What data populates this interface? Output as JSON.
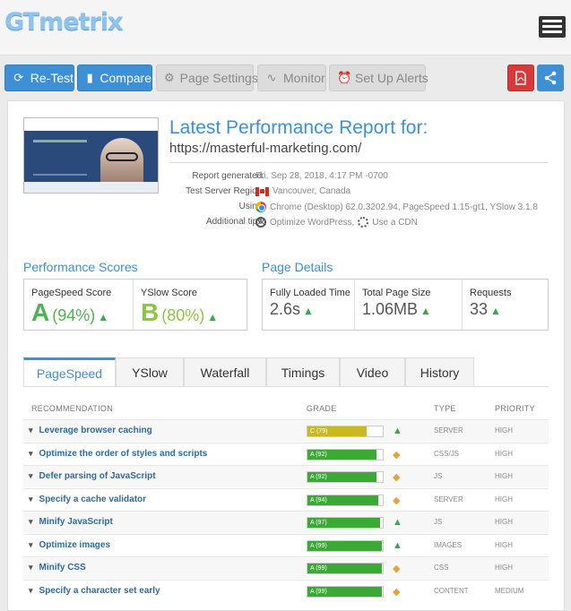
{
  "header": {
    "logo": "GTmetrix",
    "menu_icon": "hamburger-menu-icon"
  },
  "toolbar": {
    "retest": "Re-Test",
    "compare": "Compare",
    "page_settings": "Page Settings",
    "monitor": "Monitor",
    "alerts": "Set Up Alerts",
    "pdf_icon": "pdf-icon",
    "share_icon": "share-icon"
  },
  "report": {
    "title": "Latest Performance Report for:",
    "url": "https://masterful-marketing.com/",
    "meta": [
      {
        "label": "Report generated:",
        "value": "Fri, Sep 28, 2018, 4:17 PM -0700",
        "icon": ""
      },
      {
        "label": "Test Server Region:",
        "value": "Vancouver, Canada",
        "icon": "canada-flag-icon"
      },
      {
        "label": "Using:",
        "value": "Chrome (Desktop) 62.0.3202.94, PageSpeed 1.15-gt1, YSlow 3.1.8",
        "icon": "chrome-icon"
      },
      {
        "label": "Additional tips:",
        "value": "Optimize WordPress,",
        "value2": "Use a CDN",
        "icon": "wordpress-icon",
        "icon2": "cdn-icon"
      }
    ]
  },
  "scores": {
    "title": "Performance Scores",
    "pagespeed": {
      "label": "PageSpeed Score",
      "grade": "A",
      "pct": "(94%)"
    },
    "yslow": {
      "label": "YSlow Score",
      "grade": "B",
      "pct": "(80%)"
    }
  },
  "details": {
    "title": "Page Details",
    "load": {
      "label": "Fully Loaded Time",
      "value": "2.6s"
    },
    "size": {
      "label": "Total Page Size",
      "value": "1.06MB"
    },
    "requests": {
      "label": "Requests",
      "value": "33"
    }
  },
  "tabs": [
    "PageSpeed",
    "YSlow",
    "Waterfall",
    "Timings",
    "Video",
    "History"
  ],
  "table": {
    "headers": {
      "rec": "RECOMMENDATION",
      "grade": "GRADE",
      "type": "TYPE",
      "priority": "PRIORITY"
    },
    "rows": [
      {
        "name": "Leverage browser caching",
        "grade": "C (79)",
        "score": 79,
        "color": "#c9b81f",
        "trend": "up",
        "type": "SERVER",
        "priority": "HIGH"
      },
      {
        "name": "Optimize the order of styles and scripts",
        "grade": "A (92)",
        "score": 92,
        "color": "#3aaa35",
        "trend": "same",
        "type": "CSS/JS",
        "priority": "HIGH"
      },
      {
        "name": "Defer parsing of JavaScript",
        "grade": "A (92)",
        "score": 92,
        "color": "#3aaa35",
        "trend": "same",
        "type": "JS",
        "priority": "HIGH"
      },
      {
        "name": "Specify a cache validator",
        "grade": "A (94)",
        "score": 94,
        "color": "#3aaa35",
        "trend": "same",
        "type": "SERVER",
        "priority": "HIGH"
      },
      {
        "name": "Minify JavaScript",
        "grade": "A (97)",
        "score": 97,
        "color": "#3aaa35",
        "trend": "up",
        "type": "JS",
        "priority": "HIGH"
      },
      {
        "name": "Optimize images",
        "grade": "A (99)",
        "score": 99,
        "color": "#3aaa35",
        "trend": "up",
        "type": "IMAGES",
        "priority": "HIGH"
      },
      {
        "name": "Minify CSS",
        "grade": "A (99)",
        "score": 99,
        "color": "#3aaa35",
        "trend": "same",
        "type": "CSS",
        "priority": "HIGH"
      },
      {
        "name": "Specify a character set early",
        "grade": "A (99)",
        "score": 99,
        "color": "#3aaa35",
        "trend": "same",
        "type": "CONTENT",
        "priority": "MEDIUM"
      }
    ]
  }
}
